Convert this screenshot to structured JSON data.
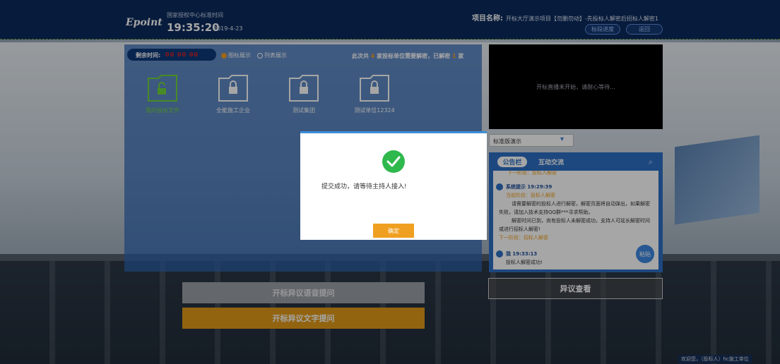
{
  "header": {
    "logo": "Epoint",
    "clock_label": "国家授权中心标准时间",
    "time": "19:35:20",
    "date": "2019-4-23",
    "project_label": "项目名称:",
    "project_name": "开标大厅演示项目【勿删勿动】-先投标人解密后招标人解密1",
    "progress_button": "标段进度",
    "back_button": "返回"
  },
  "left_panel": {
    "remaining_label": "剩余时间:",
    "remaining_value": "00 00 00",
    "view_icon": "图标展示",
    "view_list": "列表展示",
    "summary_prefix": "此次共",
    "summary_count": "4",
    "summary_mid": "家投标单位需要解密，已解密",
    "summary_done": "1",
    "summary_suffix": "家",
    "folders": [
      {
        "label": "我的投标文件",
        "icon": "unlock-icon"
      },
      {
        "label": "全能施工企业",
        "icon": "lock-icon"
      },
      {
        "label": "测试集团",
        "icon": "lock-icon"
      },
      {
        "label": "测试单位12324",
        "icon": "lock-icon"
      }
    ]
  },
  "video": {
    "message": "开标直播未开始，请耐心等待..."
  },
  "select": {
    "value": "标准版演示"
  },
  "board": {
    "tab_notice": "公告栏",
    "tab_chat": "互动交流",
    "cut_text": "下一阶段：投标人解密",
    "msg1": {
      "sender": "系统提示 19:29:39",
      "stage": "当前阶段：投标人解密",
      "line1": "请需要解密的投标人进行解密，解密页面将自动弹出，如果解密",
      "line2": "失败，请加入技术支持QQ群***寻求帮助。",
      "line3": "解密时间已到，尚有投标人未解密成功，支持人可延长解密时间",
      "line4": "或进行招标人解密!",
      "next": "下一阶段：招标人解密"
    },
    "msg2": {
      "sender": "我 19:33:13",
      "text": "投标人解密成功!"
    },
    "paste_button": "粘贴"
  },
  "buttons": {
    "voice": "开标异议语音提问",
    "text": "开标异议文字提问",
    "objection": "异议查看"
  },
  "welcome": "欢迎您，（投标人）hc施工单位",
  "modal": {
    "message": "提交成功，请等待主持人接入!",
    "ok": "确定"
  }
}
